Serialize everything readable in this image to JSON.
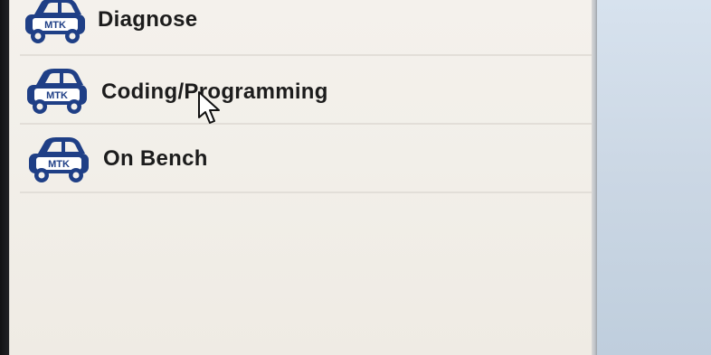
{
  "menu": {
    "items": [
      {
        "label": "Diagnose",
        "icon": "car-mtk-icon",
        "icon_text": "MTK"
      },
      {
        "label": "Coding/Programming",
        "icon": "car-mtk-icon",
        "icon_text": "MTK"
      },
      {
        "label": "On Bench",
        "icon": "car-mtk-icon",
        "icon_text": "MTK"
      }
    ]
  },
  "colors": {
    "icon_blue": "#1f3f86",
    "panel_bg": "#f4f1ec",
    "side_bg": "#cfdbe7"
  }
}
